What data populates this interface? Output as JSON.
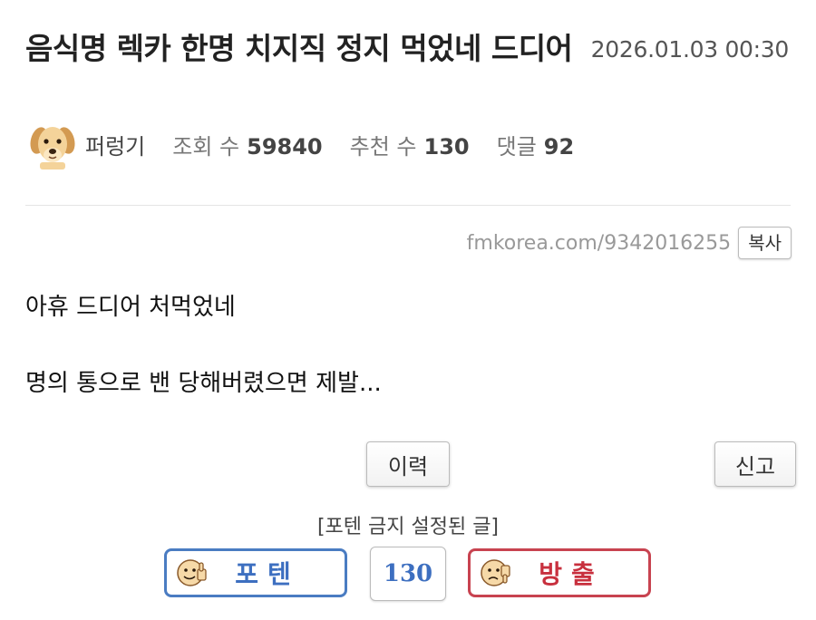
{
  "post": {
    "title": "음식명 렉카 한명 치지직 정지 먹었네 드디어",
    "date": "2026.01.03 00:30",
    "author": "퍼렁기",
    "views_label": "조회 수",
    "views": "59840",
    "recommend_label": "추천 수",
    "recommend": "130",
    "comments_label": "댓글",
    "comments": "92",
    "url": "fmkorea.com/9342016255",
    "copy_label": "복사",
    "body": [
      "아휴 드디어 처먹었네",
      "명의 통으로 밴 당해버렸으면 제발..."
    ]
  },
  "actions": {
    "history_label": "이력",
    "report_label": "신고"
  },
  "vote": {
    "notice": "[포텐 금지 설정된 글]",
    "up_label": "포텐",
    "count": "130",
    "down_label": "방출",
    "up_color": "#4a7cc2",
    "down_color": "#c84350"
  },
  "icons": {
    "avatar": "puppy-avatar-icon",
    "up_face": "thumbs-up-face-icon",
    "down_face": "thumbs-down-face-icon"
  }
}
